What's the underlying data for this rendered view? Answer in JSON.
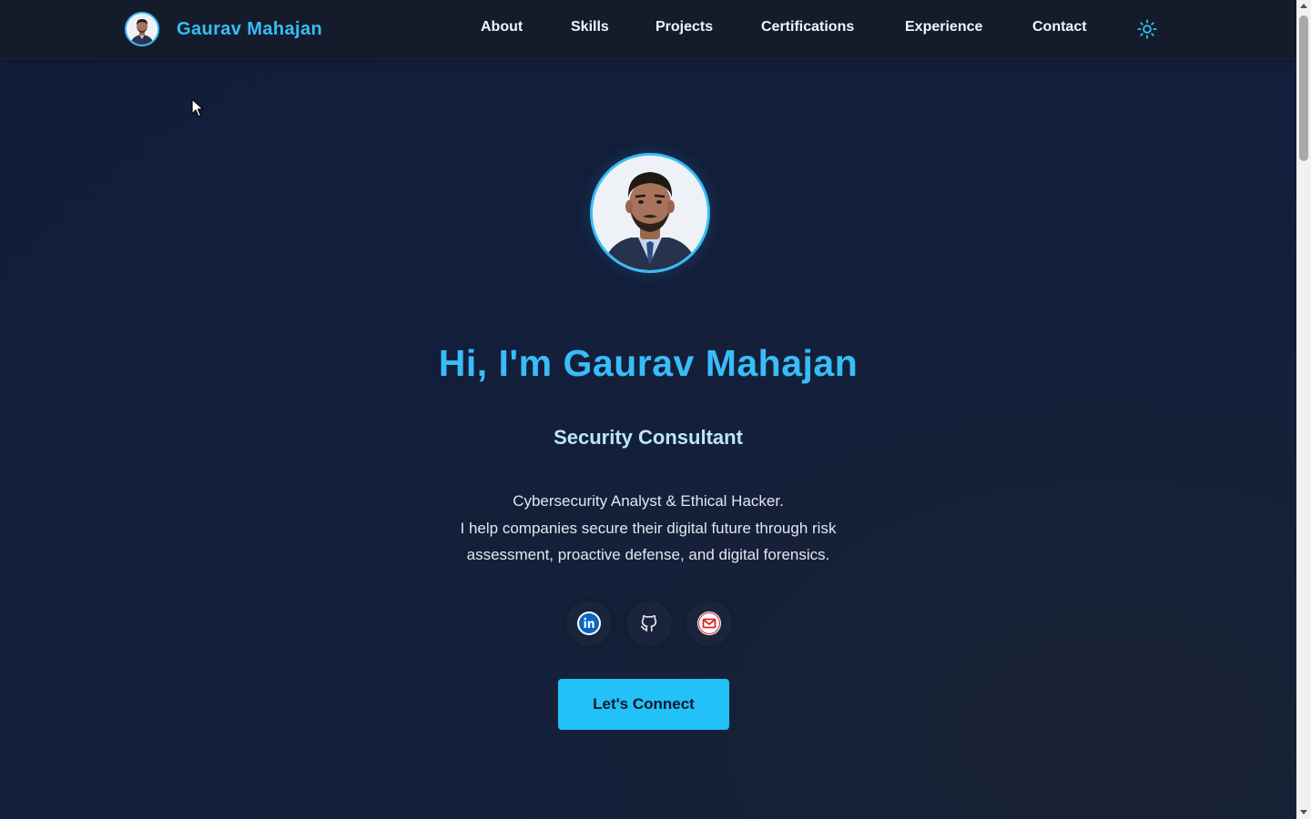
{
  "nav": {
    "brand_name": "Gaurav Mahajan",
    "links": [
      "About",
      "Skills",
      "Projects",
      "Certifications",
      "Experience",
      "Contact"
    ],
    "theme_toggle_icon": "sun-icon"
  },
  "hero": {
    "title": "Hi, I'm Gaurav Mahajan",
    "role": "Security Consultant",
    "description_lines": [
      "Cybersecurity Analyst & Ethical Hacker.",
      "I help companies secure their digital future through risk",
      "assessment, proactive defense, and digital forensics."
    ],
    "socials": [
      {
        "icon": "linkedin-icon"
      },
      {
        "icon": "github-icon"
      },
      {
        "icon": "email-icon"
      }
    ],
    "cta_label": "Let's Connect"
  },
  "colors": {
    "accent": "#38bdf8",
    "button": "#22c1f8",
    "background": "#121e3b",
    "navbar": "#141c2b"
  }
}
